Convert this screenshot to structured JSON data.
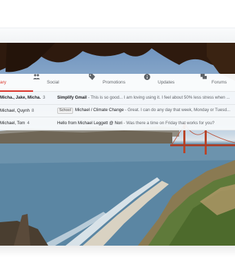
{
  "tabs": [
    {
      "label": "ary",
      "icon": "inbox-icon",
      "active": true
    },
    {
      "label": "Social",
      "icon": "people-icon",
      "active": false
    },
    {
      "label": "Promotions",
      "icon": "tag-icon",
      "active": false
    },
    {
      "label": "Updates",
      "icon": "info-icon",
      "active": false
    },
    {
      "label": "Forums",
      "icon": "forum-icon",
      "active": false
    }
  ],
  "emails": [
    {
      "sender": "Micha., Jake, Micha.",
      "count": "3",
      "label": "",
      "subject": "Simplify Gmail",
      "snippet": " - This is so good... I am loving using it. I feel about 50% less stress when ...",
      "unread": true
    },
    {
      "sender": "Michael, Quynh",
      "count": "8",
      "label": "School",
      "subject": "Michael / Climate Change",
      "snippet": " - Great. I can do any day that week, Monday or Tuesd...",
      "unread": false
    },
    {
      "sender": "Michael, Tom",
      "count": "4",
      "label": "",
      "subject": "Hello from Michael Leggett @ Nori",
      "snippet": " - Was there a time on Friday that works for you?",
      "unread": false
    }
  ],
  "colors": {
    "accent": "#d93025",
    "text": "#202124",
    "muted": "#5f6368"
  }
}
